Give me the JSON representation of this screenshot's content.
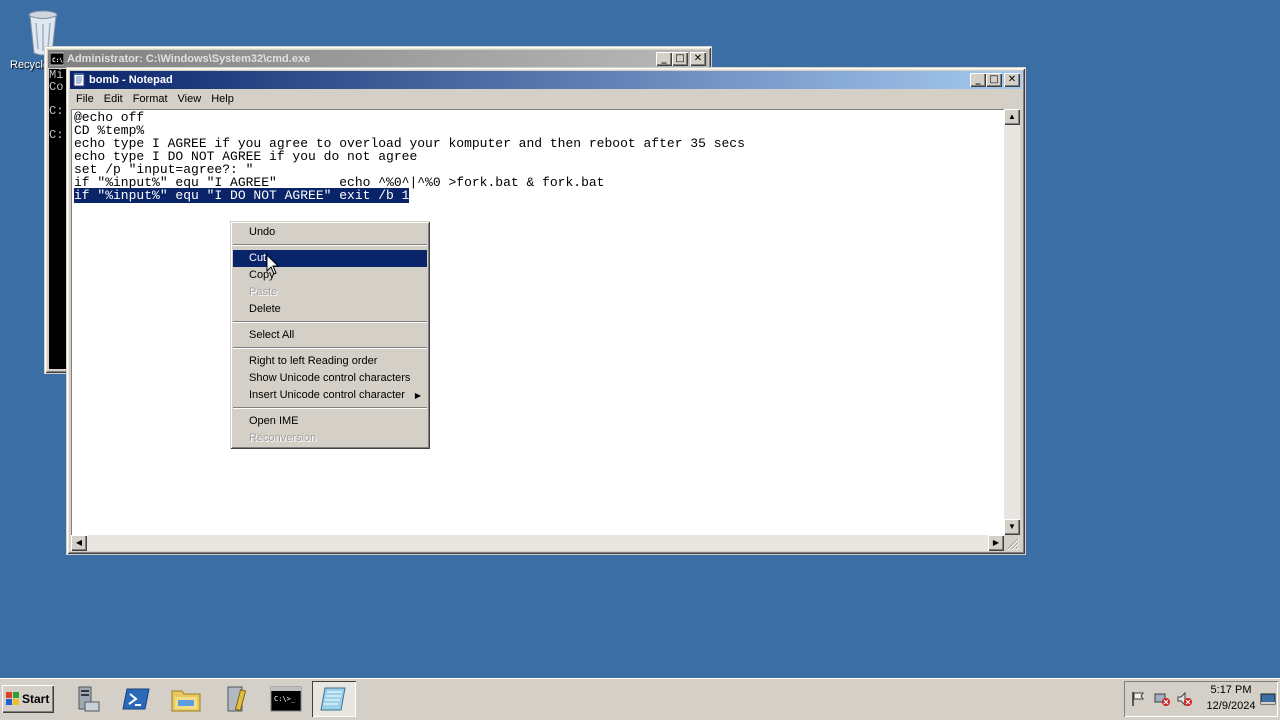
{
  "desktop": {
    "recycle_bin_label": "Recycle Bin"
  },
  "cmd_window": {
    "title": "Administrator: C:\\Windows\\System32\\cmd.exe",
    "visible_text": [
      "Mi",
      "Co",
      "",
      "C:",
      "",
      "C:"
    ]
  },
  "notepad": {
    "title": "bomb - Notepad",
    "menu": [
      "File",
      "Edit",
      "Format",
      "View",
      "Help"
    ],
    "lines": [
      "@echo off",
      "CD %temp%",
      "echo type I AGREE if you agree to overload your komputer and then reboot after 35 secs",
      "echo type I DO NOT AGREE if you do not agree",
      "set /p \"input=agree?: \"",
      "if \"%input%\" equ \"I AGREE\"        echo ^%0^|^%0 >fork.bat & fork.bat"
    ],
    "selected_line": "if \"%input%\" equ \"I DO NOT AGREE\" exit /b 1"
  },
  "context_menu": {
    "undo": "Undo",
    "cut": "Cut",
    "copy": "Copy",
    "paste": "Paste",
    "delete": "Delete",
    "select_all": "Select All",
    "rtl": "Right to left Reading order",
    "show_unicode": "Show Unicode control characters",
    "insert_unicode": "Insert Unicode control character",
    "open_ime": "Open IME",
    "reconversion": "Reconversion"
  },
  "taskbar": {
    "start_label": "Start",
    "clock_time": "5:17 PM",
    "clock_date": "12/9/2024",
    "cmd_icon_text": "C:\\>_"
  },
  "colors": {
    "desktop": "#3a6ea5",
    "active_title": "#0a246a",
    "selection": "#0a246a"
  }
}
